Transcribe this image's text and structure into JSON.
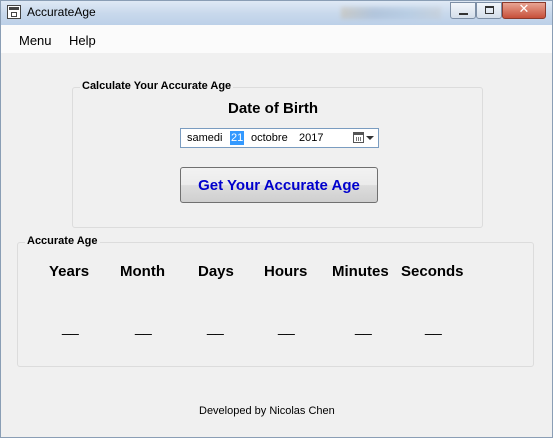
{
  "window": {
    "title": "AccurateAge"
  },
  "menubar": {
    "items": [
      "Menu",
      "Help"
    ]
  },
  "calculate_group": {
    "title": "Calculate Your Accurate Age",
    "dob_label": "Date of Birth",
    "date": {
      "day_name": "samedi",
      "day": "21",
      "month": "octobre",
      "year": "2017"
    },
    "button_label": "Get Your Accurate Age"
  },
  "age_group": {
    "title": "Accurate Age",
    "headers": [
      "Years",
      "Month",
      "Days",
      "Hours",
      "Minutes",
      "Seconds"
    ],
    "values": [
      "__",
      "__",
      "__",
      "__",
      "__",
      "__"
    ]
  },
  "footer": {
    "text": "Developed by Nicolas Chen"
  },
  "icons": {
    "app": "app-window-icon",
    "calendar": "calendar-icon",
    "dropdown": "chevron-down-icon"
  },
  "colors": {
    "button_text": "#0000cd",
    "selection": "#3399ff",
    "close_button": "#c7503a"
  }
}
